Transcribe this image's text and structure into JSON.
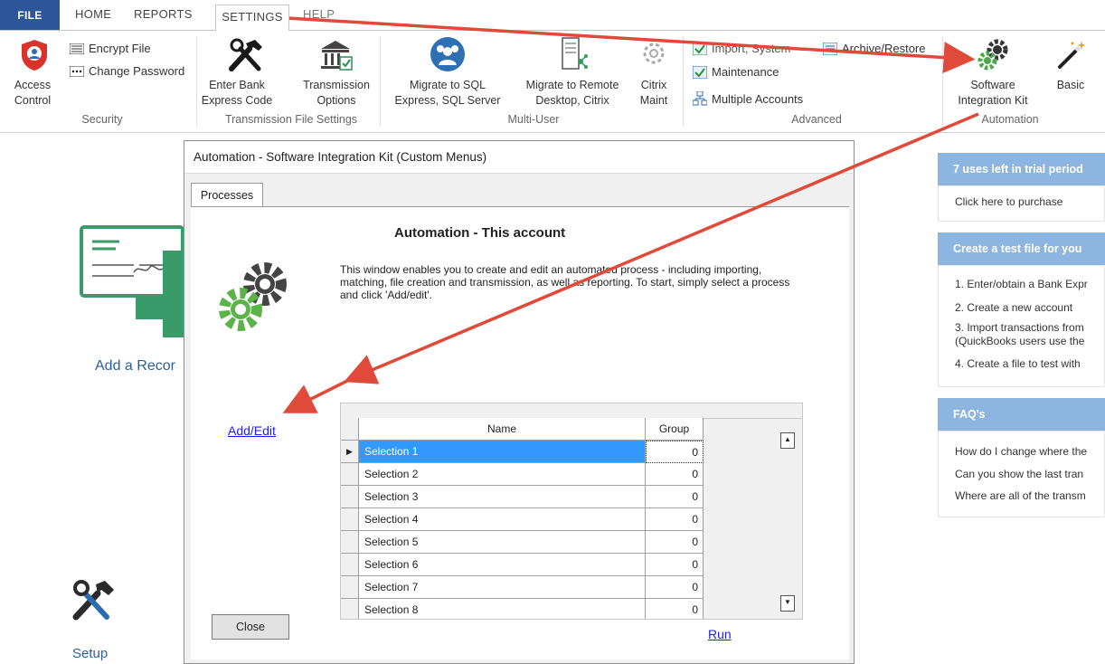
{
  "tabs": {
    "file": "FILE",
    "home": "HOME",
    "reports": "REPORTS",
    "settings": "SETTINGS",
    "help": "HELP"
  },
  "ribbon": {
    "access_control": [
      "Access",
      "Control"
    ],
    "encrypt_file": "Encrypt File",
    "change_password": "Change Password",
    "security_group": "Security",
    "enter_bank": [
      "Enter Bank",
      "Express Code"
    ],
    "transmission_options": [
      "Transmission",
      "Options"
    ],
    "transmission_group": "Transmission File Settings",
    "migrate_sql": [
      "Migrate to SQL",
      "Express, SQL Server"
    ],
    "migrate_remote": [
      "Migrate to Remote",
      "Desktop, Citrix"
    ],
    "citrix_maint": [
      "Citrix",
      "Maint"
    ],
    "multiuser_group": "Multi-User",
    "import_system": "Import, System",
    "maintenance": "Maintenance",
    "multiple_accounts": "Multiple Accounts",
    "archive_restore": "Archive/Restore",
    "advanced_group": "Advanced",
    "sik": [
      "Software",
      "Integration Kit"
    ],
    "basic": "Basic",
    "automation_group": "Automation"
  },
  "background": {
    "add_record": "Add a Recor",
    "setup": "Setup",
    "trial_header": "7 uses left in trial period",
    "purchase": "Click here to purchase",
    "test_header": "Create a test file for you",
    "steps": [
      "1. Enter/obtain a Bank Expr",
      "2. Create a new account",
      "3. Import transactions from",
      "(QuickBooks users use the",
      "4. Create a file to test with"
    ],
    "faq_header": "FAQ's",
    "faqs": [
      "How do I change where the",
      "Can you show the last tran",
      "Where are all of the transm"
    ]
  },
  "dialog": {
    "title": "Automation - Software Integration Kit (Custom Menus)",
    "tab": "Processes",
    "heading": "Automation - This account",
    "description": "This window enables you to create and edit an automated process - including importing, matching, file creation and transmission, as well as reporting.  To start, simply select a process and click 'Add/edit'.",
    "add_edit": "Add/Edit",
    "run": "Run",
    "close": "Close",
    "columns": [
      "Name",
      "Group"
    ],
    "rows": [
      {
        "name": "Selection 1",
        "group": "0"
      },
      {
        "name": "Selection 2",
        "group": "0"
      },
      {
        "name": "Selection 3",
        "group": "0"
      },
      {
        "name": "Selection 4",
        "group": "0"
      },
      {
        "name": "Selection 5",
        "group": "0"
      },
      {
        "name": "Selection 6",
        "group": "0"
      },
      {
        "name": "Selection 7",
        "group": "0"
      },
      {
        "name": "Selection 8",
        "group": "0"
      }
    ],
    "selected_row_color": "#3399ff"
  },
  "colors": {
    "accent": "#2b579a",
    "arrow": "#e04a3a",
    "panel_header": "#8db5e2",
    "link": "#1a1aff"
  }
}
